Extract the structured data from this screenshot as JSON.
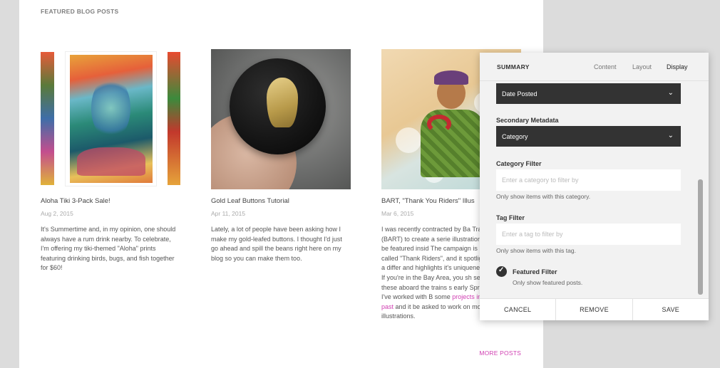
{
  "section": {
    "title": "FEATURED BLOG POSTS"
  },
  "posts": [
    {
      "title": "Aloha Tiki 3-Pack Sale!",
      "date": "Aug 2, 2015",
      "excerpt": "It's Summertime and, in my opinion, one should always have a rum drink nearby. To celebrate, I'm offering my tiki-themed \"Aloha\" prints featuring drinking birds, bugs, and fish together for $60!"
    },
    {
      "title": "Gold Leaf Buttons Tutorial",
      "date": "Apr 11, 2015",
      "excerpt": "Lately, a lot of people have been asking how I make my gold-leafed buttons. I thought I'd just go ahead and spill the beans right here on my blog so you can make them too."
    },
    {
      "title": "BART, \"Thank You Riders\" Illus",
      "date": "Mar 6, 2015",
      "excerpt_before": "I was recently contracted by Ba Transit (BART) to create a serie illustrations to be featured insid The campaign is called \"Thank Riders\", and it spotlights a differ and highlights it's uniqueness in If you're in the Bay Area, you sh seeing these aboard the trains s early Spring. I've worked with B some ",
      "excerpt_link": "projects in the past",
      "excerpt_after": " and it be asked to work on more illustrations."
    }
  ],
  "more_posts": "MORE POSTS",
  "panel": {
    "header": {
      "title": "SUMMARY",
      "tabs": [
        "Content",
        "Layout",
        "Display"
      ],
      "active_tab": "Display"
    },
    "primary_metadata": {
      "value": "Date Posted"
    },
    "secondary_metadata": {
      "label": "Secondary Metadata",
      "value": "Category"
    },
    "category_filter": {
      "label": "Category Filter",
      "placeholder": "Enter a category to filter by",
      "hint": "Only show items with this category."
    },
    "tag_filter": {
      "label": "Tag Filter",
      "placeholder": "Enter a tag to filter by",
      "hint": "Only show items with this tag."
    },
    "featured_filter": {
      "label": "Featured Filter",
      "hint": "Only show featured posts.",
      "checked": true
    },
    "footer": {
      "cancel": "CANCEL",
      "remove": "REMOVE",
      "save": "SAVE"
    }
  },
  "icons": {
    "chevron": "chevron-down-icon",
    "check": "checkmark-icon"
  }
}
